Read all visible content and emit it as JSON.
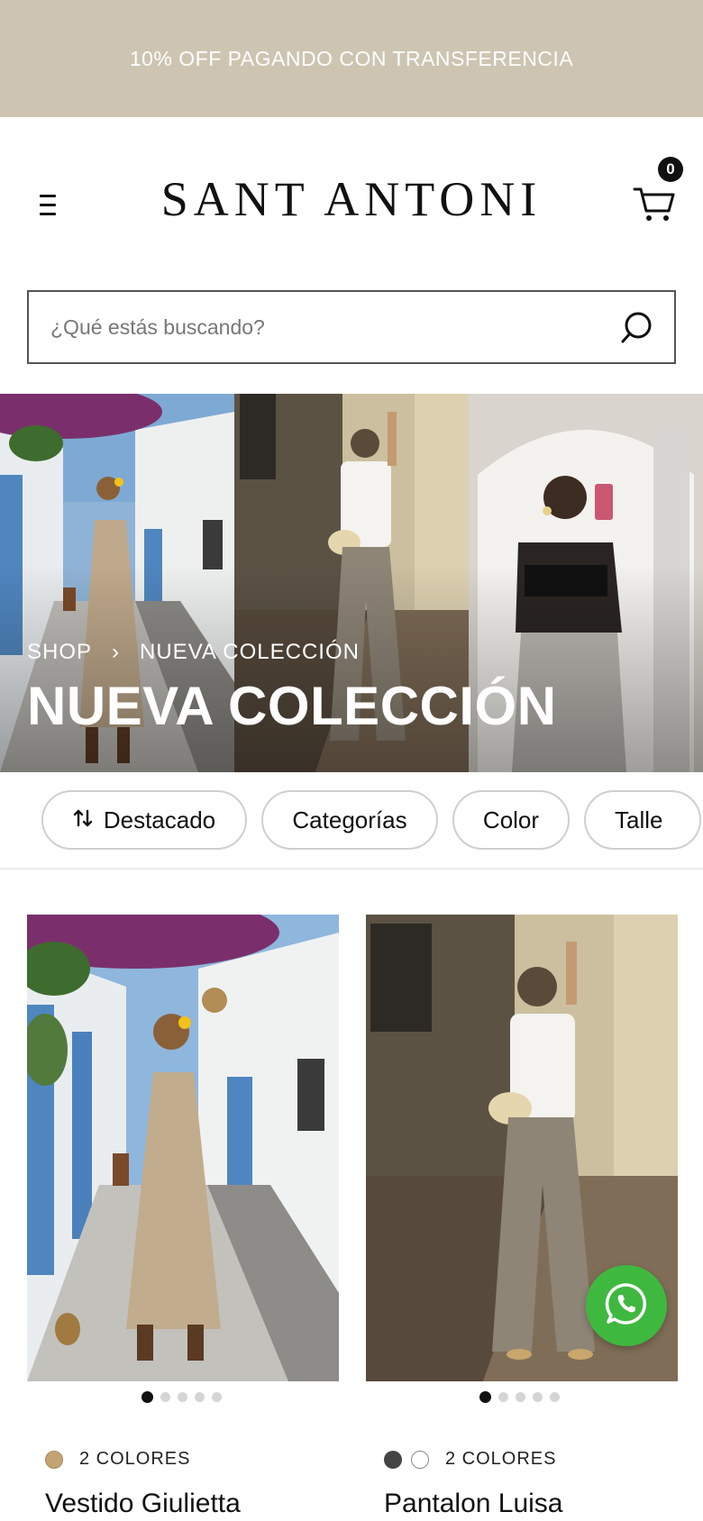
{
  "announcement": {
    "text": "10% OFF PAGANDO CON TRANSFERENCIA",
    "bg_color": "#cdc5b2"
  },
  "header": {
    "logo": "SANT ANTONI",
    "menu_icon": "hamburger-menu-icon",
    "cart_icon": "cart-icon",
    "cart_count": "0"
  },
  "search": {
    "placeholder": "¿Qué estás buscando?",
    "value": "",
    "icon": "search-icon"
  },
  "hero": {
    "breadcrumb": [
      "SHOP",
      "›",
      "NUEVA COLECCIÓN"
    ],
    "title": "NUEVA COLECCIÓN"
  },
  "filters": [
    {
      "label": "Destacado",
      "icon": "sort-arrows-icon"
    },
    {
      "label": "Categorías"
    },
    {
      "label": "Color"
    },
    {
      "label": "Talle"
    }
  ],
  "products": [
    {
      "name": "Vestido Giulietta",
      "colors_label": "2 COLORES",
      "swatches": [
        "#c4a372"
      ],
      "image_dots": 5,
      "active_dot": 0
    },
    {
      "name": "Pantalon Luisa",
      "colors_label": "2 COLORES",
      "swatches": [
        "#444444",
        "#ffffff"
      ],
      "image_dots": 5,
      "active_dot": 0
    }
  ],
  "whatsapp": {
    "icon": "whatsapp-icon",
    "color": "#3fb83f"
  }
}
